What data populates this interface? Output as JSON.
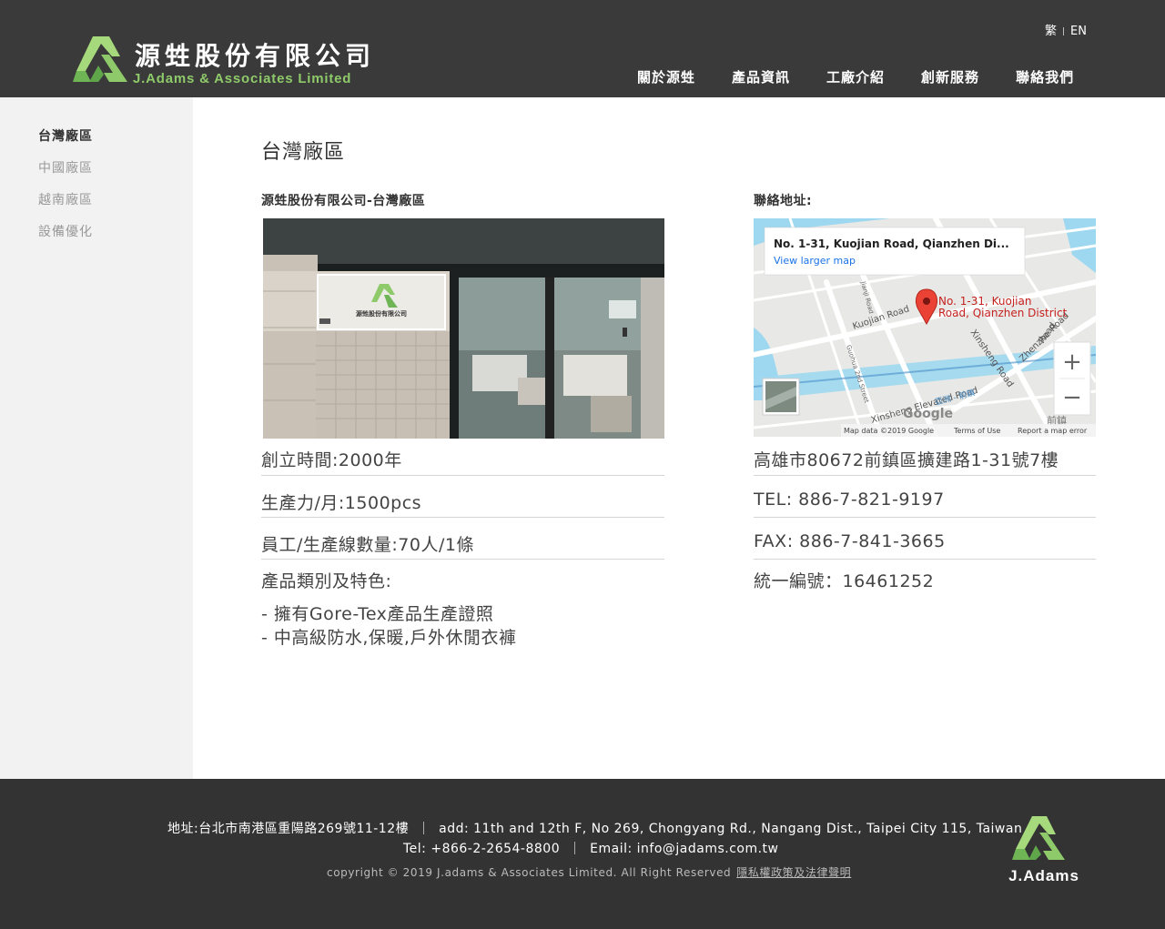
{
  "header": {
    "logo_cn": "源甡股份有限公司",
    "logo_en": "J.Adams & Associates Limited",
    "lang_tc": "繁",
    "lang_en": "EN",
    "nav": [
      "關於源甡",
      "產品資訊",
      "工廠介紹",
      "創新服務",
      "聯絡我們"
    ]
  },
  "sidebar": {
    "items": [
      "台灣廠區",
      "中國廠區",
      "越南廠區",
      "設備優化"
    ],
    "active_index": 0
  },
  "main": {
    "title": "台灣廠區",
    "left_heading": "源甡股份有限公司-台灣廠區",
    "right_heading": "聯絡地址:",
    "photo_sign": "源甡股份有限公司",
    "left_rows": [
      "創立時間:2000年",
      "生產力/月:1500pcs",
      "員工/生產線數量:70人/1條"
    ],
    "features_label": "產品類別及特色:",
    "features": [
      "- 擁有Gore-Tex產品生產證照",
      "- 中高級防水,保暖,戶外休閒衣褲"
    ],
    "right_rows": [
      "高雄市80672前鎮區擴建路1-31號7樓",
      "TEL: 886-7-821-9197",
      "FAX: 886-7-841-3665",
      "統一編號：16461252"
    ]
  },
  "map": {
    "card_title": "No. 1-31, Kuojian Road, Qianzhen Di...",
    "card_link": "View larger map",
    "pin_label_1": "No. 1-31, Kuojian",
    "pin_label_2": "Road, Qianzhen District",
    "roads": [
      "Kuojian Road",
      "Jianji Road",
      "Guohua 2nd Street",
      "Xinsheng Road",
      "Zhenzhe Road",
      "Xinsheng Elevated Road",
      "Road"
    ],
    "zoom_in": "+",
    "zoom_out": "−",
    "google": "Google",
    "cjk_label": "前鎮",
    "cjk_label_2": "亞洲 - 前鎮",
    "attrib_data": "Map data ©2019 Google",
    "attrib_terms": "Terms of Use",
    "attrib_report": "Report a map error"
  },
  "footer": {
    "addr_cn": "地址:台北市南港區重陽路269號11-12樓",
    "addr_en": "add: 11th and 12th F, No 269, Chongyang Rd., Nangang Dist., Taipei City 115, Taiwan",
    "tel": "Tel: +866-2-2654-8800",
    "email": "Email: info@jadams.com.tw",
    "copyright": "copyright © 2019 J.adams & Associates Limited. All Right Reserved",
    "privacy": "隱私權政策及法律聲明",
    "logo_text": "J.Adams"
  },
  "colors": {
    "header_bg": "#3a3a3a",
    "footer_bg": "#333333",
    "sidebar_bg": "#f2f2f2",
    "brand_green": "#8fca6a",
    "map_pin": "#ea4335",
    "map_link": "#1a73e8"
  }
}
